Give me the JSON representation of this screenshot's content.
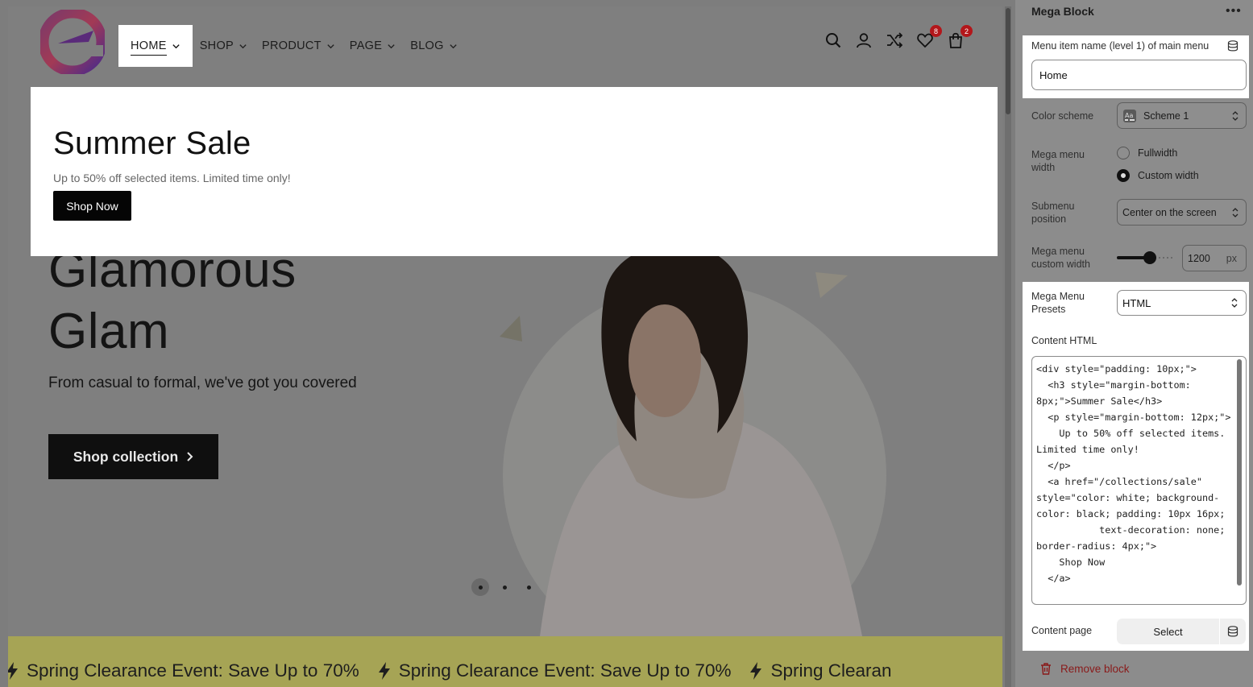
{
  "header": {
    "nav": [
      {
        "label": "HOME",
        "active": true
      },
      {
        "label": "SHOP"
      },
      {
        "label": "PRODUCT"
      },
      {
        "label": "PAGE"
      },
      {
        "label": "BLOG"
      }
    ],
    "wishlist_count": "8",
    "cart_count": "2"
  },
  "mega_menu": {
    "title": "Summer Sale",
    "text": "Up to 50% off selected items. Limited time only!",
    "button": "Shop Now"
  },
  "hero": {
    "title_line1": "Glamorous",
    "title_line2": "Glam",
    "subtitle": "From casual to formal, we've got you covered",
    "button": "Shop collection",
    "slide_count": 3,
    "active_slide": 1
  },
  "marquee": {
    "text": "Spring Clearance Event: Save Up to 70%",
    "text_partial": "Spring Clearan"
  },
  "panel": {
    "title": "Mega Block",
    "menu_name_label": "Menu item name (level 1) of main menu",
    "menu_name_value": "Home",
    "color_scheme_label": "Color scheme",
    "color_scheme_value": "Scheme 1",
    "width_label": "Mega menu width",
    "width_options": [
      "Fullwidth",
      "Custom width"
    ],
    "width_selected": "Custom width",
    "submenu_label": "Submenu position",
    "submenu_value": "Center on the screen",
    "custom_width_label": "Mega menu custom width",
    "custom_width_value": "1200",
    "custom_width_unit": "px",
    "custom_width_fraction": 0.3,
    "presets_label": "Mega Menu Presets",
    "presets_value": "HTML",
    "content_html_label": "Content HTML",
    "content_html": "<div style=\"padding: 10px;\">\n  <h3 style=\"margin-bottom: 8px;\">Summer Sale</h3>\n  <p style=\"margin-bottom: 12px;\">\n    Up to 50% off selected items. Limited time only!\n  </p>\n  <a href=\"/collections/sale\" style=\"color: white; background-color: black; padding: 10px 16px;\n           text-decoration: none; border-radius: 4px;\">\n    Shop Now\n  </a>",
    "content_page_label": "Content page",
    "select_label": "Select",
    "remove_label": "Remove block"
  },
  "colors": {
    "badge": "#b3161a",
    "remove": "#8a1a1a",
    "marquee_bg": "#a6a455"
  }
}
